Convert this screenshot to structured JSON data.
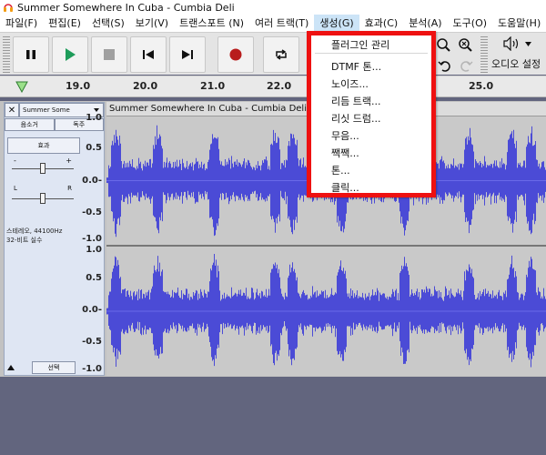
{
  "window": {
    "title": "Summer Somewhere In Cuba - Cumbia Deli"
  },
  "menubar": {
    "items": [
      {
        "label": "파일(F)",
        "active": false
      },
      {
        "label": "편집(E)",
        "active": false
      },
      {
        "label": "선택(S)",
        "active": false
      },
      {
        "label": "보기(V)",
        "active": false
      },
      {
        "label": "트랜스포트 (N)",
        "active": false
      },
      {
        "label": "여러 트랙(T)",
        "active": false
      },
      {
        "label": "생성(G)",
        "active": true
      },
      {
        "label": "효과(C)",
        "active": false
      },
      {
        "label": "분석(A)",
        "active": false
      },
      {
        "label": "도구(O)",
        "active": false
      },
      {
        "label": "도움말(H)",
        "active": false
      }
    ]
  },
  "toolbar": {
    "buttons": [
      "pause",
      "play",
      "stop",
      "skip-to-start",
      "skip-to-end",
      "record",
      "loop"
    ],
    "audio_settings_label": "오디오 설정"
  },
  "ruler": {
    "ticks": [
      "19.0",
      "20.0",
      "21.0",
      "22.0",
      "25.0"
    ]
  },
  "track": {
    "name": "Summer Some",
    "mute_label": "음소거",
    "solo_label": "독주",
    "effects_label": "효과",
    "gain_minus": "-",
    "gain_plus": "+",
    "pan_left": "L",
    "pan_right": "R",
    "info_line1": "스테레오, 44100Hz",
    "info_line2": "32-비트 실수",
    "select_label": "선택",
    "gain_level": 0.5,
    "pan_level": 0.5
  },
  "vertical_ruler": {
    "top_channel": [
      "1.0",
      "0.5",
      "0.0-",
      "-0.5",
      "-1.0"
    ],
    "bottom_channel": [
      "1.0",
      "0.5",
      "0.0-",
      "-0.5",
      "-1.0"
    ]
  },
  "clip": {
    "title": "Summer Somewhere In Cuba - Cumbia Deli"
  },
  "generate_menu": {
    "items": [
      "플러그인 관리",
      "DTMF 톤...",
      "노이즈...",
      "리듬 트랙...",
      "리싯 드럼...",
      "무음...",
      "짹짹...",
      "톤...",
      "클릭..."
    ]
  },
  "colors": {
    "waveform": "#4b4bd6",
    "highlight": "#ee1111",
    "background": "#62657e"
  }
}
